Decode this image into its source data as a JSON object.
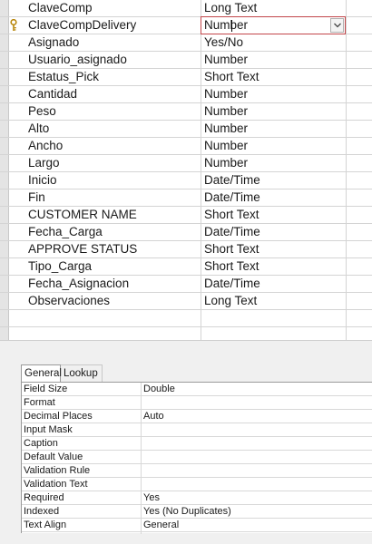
{
  "fields": [
    {
      "name": "ClaveComp",
      "type": "Long Text"
    },
    {
      "name": "ClaveCompDelivery",
      "type": "Number",
      "primary_key": true,
      "editing": true
    },
    {
      "name": "Asignado",
      "type": "Yes/No"
    },
    {
      "name": "Usuario_asignado",
      "type": "Number"
    },
    {
      "name": "Estatus_Pick",
      "type": "Short Text"
    },
    {
      "name": "Cantidad",
      "type": "Number"
    },
    {
      "name": "Peso",
      "type": "Number"
    },
    {
      "name": "Alto",
      "type": "Number"
    },
    {
      "name": "Ancho",
      "type": "Number"
    },
    {
      "name": "Largo",
      "type": "Number"
    },
    {
      "name": "Inicio",
      "type": "Date/Time"
    },
    {
      "name": "Fin",
      "type": "Date/Time"
    },
    {
      "name": "CUSTOMER NAME",
      "type": "Short Text"
    },
    {
      "name": "Fecha_Carga",
      "type": "Date/Time"
    },
    {
      "name": "APPROVE STATUS",
      "type": "Short Text"
    },
    {
      "name": "Tipo_Carga",
      "type": "Short Text"
    },
    {
      "name": "Fecha_Asignacion",
      "type": "Date/Time"
    },
    {
      "name": "Observaciones",
      "type": "Long Text"
    },
    {
      "name": "",
      "type": ""
    },
    {
      "name": "",
      "type": ""
    }
  ],
  "tabs": {
    "general": "General",
    "lookup": "Lookup"
  },
  "properties": [
    {
      "label": "Field Size",
      "value": "Double"
    },
    {
      "label": "Format",
      "value": ""
    },
    {
      "label": "Decimal Places",
      "value": "Auto"
    },
    {
      "label": "Input Mask",
      "value": ""
    },
    {
      "label": "Caption",
      "value": ""
    },
    {
      "label": "Default Value",
      "value": ""
    },
    {
      "label": "Validation Rule",
      "value": ""
    },
    {
      "label": "Validation Text",
      "value": ""
    },
    {
      "label": "Required",
      "value": "Yes"
    },
    {
      "label": "Indexed",
      "value": "Yes (No Duplicates)"
    },
    {
      "label": "Text Align",
      "value": "General"
    }
  ],
  "icons": {
    "primary_key": "key-icon",
    "dropdown": "chevron-down-icon"
  },
  "colors": {
    "active_border": "#c2474a",
    "key_gold": "#d4a017"
  }
}
